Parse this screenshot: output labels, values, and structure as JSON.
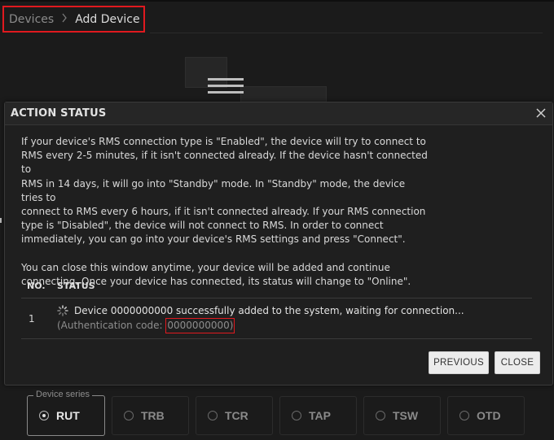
{
  "breadcrumb": {
    "root": "Devices",
    "separator": "›",
    "current": "Add Device"
  },
  "modal": {
    "title": "ACTION STATUS",
    "close_icon": "close-icon",
    "paragraph1": "If your device's RMS connection type is \"Enabled\", the device will try to connect to\nRMS every 2-5 minutes, if it isn't connected already. If the device hasn't connected to\nRMS in 14 days, it will go into \"Standby\" mode. In \"Standby\" mode, the device tries to\nconnect to RMS every 6 hours, if it isn't connected already. If your RMS connection\ntype is \"Disabled\", the device will not connect to RMS. In order to connect\nimmediately, you can go into your device's RMS settings and press \"Connect\".",
    "paragraph2": "You can close this window anytime, your device will be added and continue\nconnecting. Once your device has connected, its status will change to \"Online\".",
    "table": {
      "headers": {
        "no": "NO.",
        "status": "STATUS"
      },
      "rows": [
        {
          "no": "1",
          "status_icon": "spinner-icon",
          "message": "Device 0000000000 successfully added to the system, waiting for connection...",
          "auth_prefix": "(Authentication code: ",
          "auth_code": "0000000000)"
        }
      ]
    },
    "buttons": {
      "previous": "PREVIOUS",
      "close": "CLOSE"
    }
  },
  "device_series": {
    "legend": "Device series",
    "selected": "RUT",
    "options": [
      "RUT",
      "TRB",
      "TCR",
      "TAP",
      "TSW",
      "OTD"
    ]
  },
  "colors": {
    "highlight": "#e0191f",
    "background": "#1b1b1b",
    "button_bg": "#ececec"
  }
}
